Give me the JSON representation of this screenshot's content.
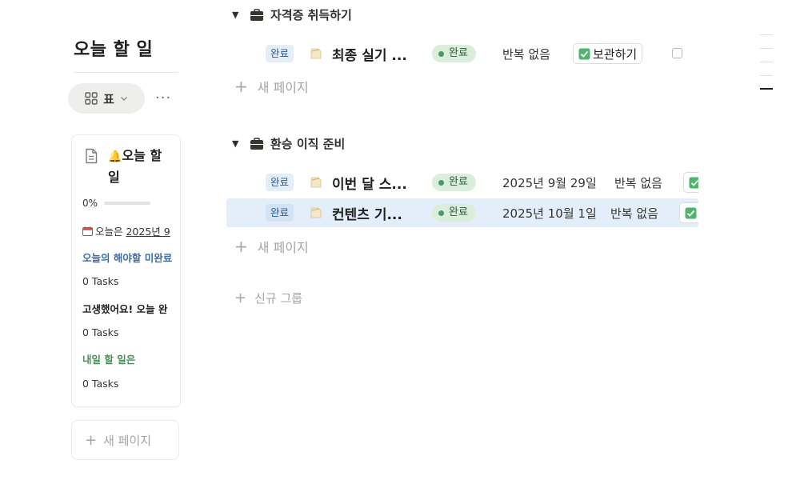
{
  "board": {
    "title": "오늘 할 일",
    "view_label": "표",
    "more_label": "···"
  },
  "card": {
    "icon": "🔔",
    "title": "오늘 할 일",
    "progress_text": "0%",
    "progress_value": 0,
    "today_prefix": "오늘은 ",
    "today_date": "2025년 9",
    "undone_label": "오늘의 해야할 미완료",
    "tasks_1": "0 Tasks",
    "done_label": "고생했어요! 오늘 완",
    "tasks_2": "0 Tasks",
    "tomorrow_label": "내일 할 일은",
    "tasks_3": "0 Tasks"
  },
  "new_page_label": "새 페이지",
  "groups": [
    {
      "name": "자격증 취득하기",
      "rows": [
        {
          "tag": "완료",
          "title": "최종 실기 ...",
          "status": "완료",
          "date": "",
          "repeat": "반복 없음",
          "archive": "보관하기"
        }
      ],
      "add_label": "새 페이지"
    },
    {
      "name": "환승 이직 준비",
      "rows": [
        {
          "tag": "완료",
          "title": "이번 달 스...",
          "status": "완료",
          "date": "2025년 9월 29일",
          "repeat": "반복 없음"
        },
        {
          "tag": "완료",
          "title": "컨텐츠 기...",
          "status": "완료",
          "date": "2025년 10월 1일",
          "repeat": "반복 없음"
        }
      ],
      "add_label": "새 페이지"
    }
  ],
  "new_group_label": "신규 그룹",
  "colors": {
    "tag_bg": "#e5eef7",
    "status_bg": "#dbeddb",
    "selected_row": "#e3eefa",
    "accent_green": "#4f9768"
  },
  "icons": {
    "view": "grid-icon",
    "card_page": "document-icon",
    "group": "briefcase-icon",
    "row_page": "page-icon",
    "archive": "check-mark-icon"
  }
}
